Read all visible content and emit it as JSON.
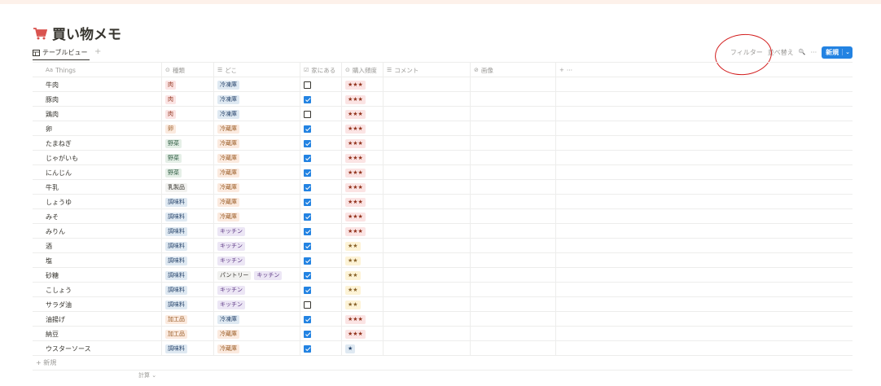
{
  "page": {
    "title": "買い物メモ",
    "view_tab": "テーブルビュー",
    "view_add": "+",
    "toolbar": {
      "filter": "フィルター",
      "sort": "並べ替え",
      "search_icon": "🔍",
      "more": "···",
      "new": "新規",
      "new_chevron": "⌄"
    }
  },
  "colors": {
    "accent": "#2383e2",
    "annotation_circle": "#d21c1c",
    "tags": {
      "肉": {
        "bg": "#fbe4e4",
        "fg": "#93341e"
      },
      "卵": {
        "bg": "#fbeadf",
        "fg": "#9a5b24"
      },
      "野菜": {
        "bg": "#e5efe7",
        "fg": "#2b593f"
      },
      "乳製品": {
        "bg": "#f1f1ef",
        "fg": "#37352f"
      },
      "調味料": {
        "bg": "#dfe9f2",
        "fg": "#28456c"
      },
      "加工品": {
        "bg": "#fbeadf",
        "fg": "#9a5b24"
      },
      "冷凍庫": {
        "bg": "#dfe9f2",
        "fg": "#28456c"
      },
      "冷蔵庫": {
        "bg": "#fbeadf",
        "fg": "#9a5b24"
      },
      "キッチン": {
        "bg": "#ece6f5",
        "fg": "#5e3a86"
      },
      "パントリー": {
        "bg": "#f1f1ef",
        "fg": "#37352f"
      },
      "★★★": {
        "bg": "#fbe4e4",
        "fg": "#93341e"
      },
      "★★": {
        "bg": "#fdf3d6",
        "fg": "#89632a"
      },
      "★": {
        "bg": "#dfe9f2",
        "fg": "#28456c"
      }
    }
  },
  "table": {
    "columns": [
      {
        "icon": "Aa",
        "label": "Things"
      },
      {
        "icon": "⊙",
        "label": "種類"
      },
      {
        "icon": "☰",
        "label": "どこ"
      },
      {
        "icon": "☑",
        "label": "家にある"
      },
      {
        "icon": "⊙",
        "label": "購入頻度"
      },
      {
        "icon": "☰",
        "label": "コメント"
      },
      {
        "icon": "⊘",
        "label": "画像"
      },
      {
        "icon": "+",
        "label": "···"
      }
    ],
    "rows": [
      {
        "name": "牛肉",
        "kind": "肉",
        "where": [
          "冷凍庫"
        ],
        "home": false,
        "freq": "★★★"
      },
      {
        "name": "豚肉",
        "kind": "肉",
        "where": [
          "冷凍庫"
        ],
        "home": true,
        "freq": "★★★"
      },
      {
        "name": "鶏肉",
        "kind": "肉",
        "where": [
          "冷凍庫"
        ],
        "home": false,
        "freq": "★★★"
      },
      {
        "name": "卵",
        "kind": "卵",
        "where": [
          "冷蔵庫"
        ],
        "home": true,
        "freq": "★★★"
      },
      {
        "name": "たまねぎ",
        "kind": "野菜",
        "where": [
          "冷蔵庫"
        ],
        "home": true,
        "freq": "★★★"
      },
      {
        "name": "じゃがいも",
        "kind": "野菜",
        "where": [
          "冷蔵庫"
        ],
        "home": true,
        "freq": "★★★"
      },
      {
        "name": "にんじん",
        "kind": "野菜",
        "where": [
          "冷蔵庫"
        ],
        "home": true,
        "freq": "★★★"
      },
      {
        "name": "牛乳",
        "kind": "乳製品",
        "where": [
          "冷蔵庫"
        ],
        "home": true,
        "freq": "★★★"
      },
      {
        "name": "しょうゆ",
        "kind": "調味料",
        "where": [
          "冷蔵庫"
        ],
        "home": true,
        "freq": "★★★"
      },
      {
        "name": "みそ",
        "kind": "調味料",
        "where": [
          "冷蔵庫"
        ],
        "home": true,
        "freq": "★★★"
      },
      {
        "name": "みりん",
        "kind": "調味料",
        "where": [
          "キッチン"
        ],
        "home": true,
        "freq": "★★★"
      },
      {
        "name": "酒",
        "kind": "調味料",
        "where": [
          "キッチン"
        ],
        "home": true,
        "freq": "★★"
      },
      {
        "name": "塩",
        "kind": "調味料",
        "where": [
          "キッチン"
        ],
        "home": true,
        "freq": "★★"
      },
      {
        "name": "砂糖",
        "kind": "調味料",
        "where": [
          "パントリー",
          "キッチン"
        ],
        "home": true,
        "freq": "★★"
      },
      {
        "name": "こしょう",
        "kind": "調味料",
        "where": [
          "キッチン"
        ],
        "home": true,
        "freq": "★★"
      },
      {
        "name": "サラダ油",
        "kind": "調味料",
        "where": [
          "キッチン"
        ],
        "home": false,
        "freq": "★★"
      },
      {
        "name": "油揚げ",
        "kind": "加工品",
        "where": [
          "冷凍庫"
        ],
        "home": true,
        "freq": "★★★"
      },
      {
        "name": "納豆",
        "kind": "加工品",
        "where": [
          "冷蔵庫"
        ],
        "home": true,
        "freq": "★★★"
      },
      {
        "name": "ウスターソース",
        "kind": "調味料",
        "where": [
          "冷蔵庫"
        ],
        "home": true,
        "freq": "★"
      }
    ],
    "add_row": "+ 新規",
    "calc": "計算 ⌄"
  }
}
